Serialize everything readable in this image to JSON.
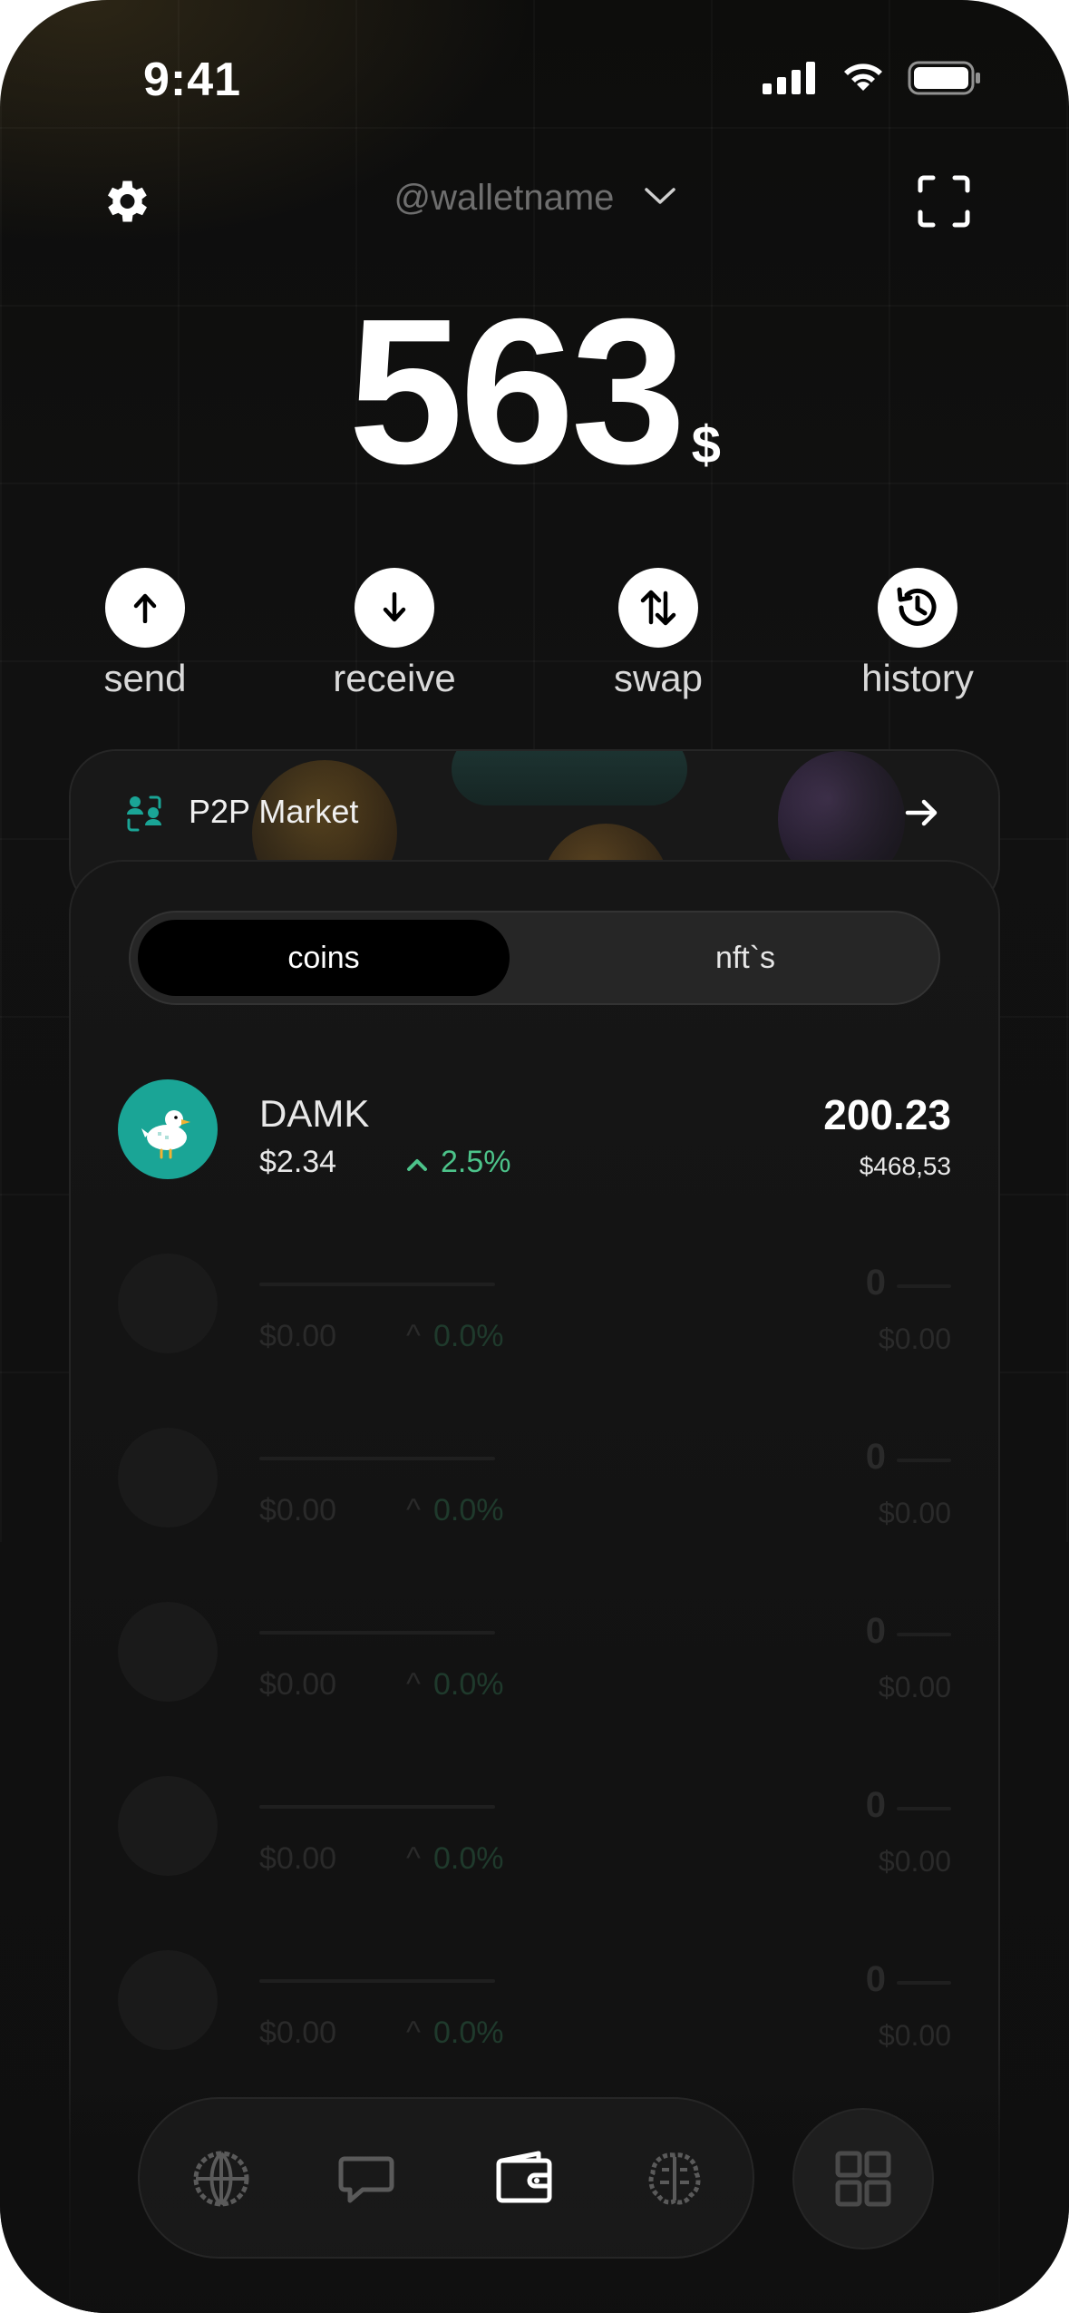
{
  "status_bar": {
    "time": "9:41"
  },
  "header": {
    "wallet_name": "@walletname"
  },
  "balance": {
    "amount": "563",
    "currency": "$"
  },
  "actions": [
    {
      "label": "send",
      "icon": "arrow-up-icon"
    },
    {
      "label": "receive",
      "icon": "arrow-down-icon"
    },
    {
      "label": "swap",
      "icon": "swap-icon"
    },
    {
      "label": "history",
      "icon": "history-icon"
    }
  ],
  "p2p": {
    "title": "P2P Market"
  },
  "tabs": {
    "coins": "coins",
    "nfts": "nft`s",
    "active": "coins"
  },
  "coins": [
    {
      "name": "DAMK",
      "price": "$2.34",
      "change": "2.5%",
      "amount": "200.23",
      "fiat": "$468,53",
      "logo_color": "#1aa596"
    }
  ],
  "placeholders": [
    {
      "price": "$0.00",
      "change": "0.0%",
      "amount": "0",
      "fiat": "$0.00"
    },
    {
      "price": "$0.00",
      "change": "0.0%",
      "amount": "0",
      "fiat": "$0.00"
    },
    {
      "price": "$0.00",
      "change": "0.0%",
      "amount": "0",
      "fiat": "$0.00"
    },
    {
      "price": "$0.00",
      "change": "0.0%",
      "amount": "0",
      "fiat": "$0.00"
    },
    {
      "price": "$0.00",
      "change": "0.0%",
      "amount": "0",
      "fiat": "$0.00"
    }
  ],
  "nav": {
    "items": [
      "globe-icon",
      "chat-icon",
      "wallet-icon",
      "brain-icon"
    ],
    "active": "wallet-icon",
    "more": "grid-icon"
  },
  "colors": {
    "accent_green": "#4cc38a",
    "coin_teal": "#1aa596",
    "background": "#0f0f0f"
  }
}
